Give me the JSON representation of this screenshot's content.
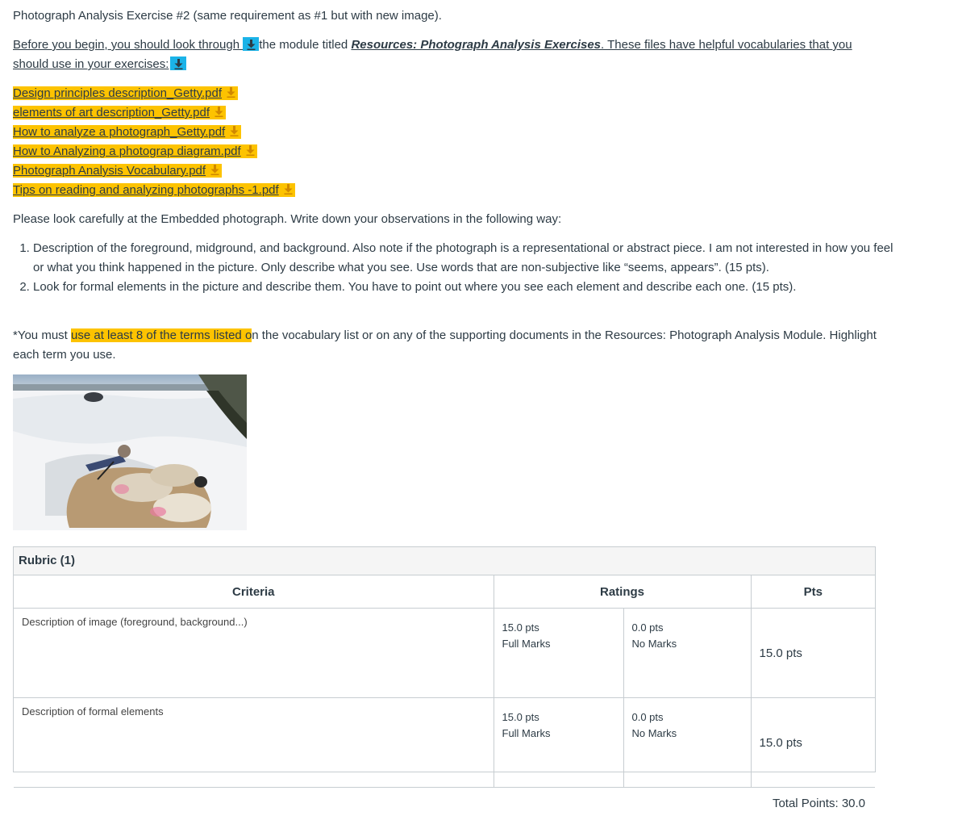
{
  "intro": "Photograph Analysis Exercise #2 (same requirement as #1 but with new image).",
  "before": {
    "part1": "Before you begin, you should look through ",
    "part2": "the module titled ",
    "module_link": "Resources: Photograph Analysis Exercises",
    "part3": ". These files have helpful vocabularies that you should use in your exercises:"
  },
  "files": [
    {
      "name": "Design principles description_Getty.pdf"
    },
    {
      "name": "elements of art description_Getty.pdf"
    },
    {
      "name": "How to analyze a photograph_Getty.pdf"
    },
    {
      "name": "How to Analyzing a photograp diagram.pdf"
    },
    {
      "name": "Photograph Analysis Vocabulary.pdf"
    },
    {
      "name": "Tips on reading and analyzing photographs -1.pdf"
    }
  ],
  "instruction": "Please look carefully at the Embedded photograph. Write down your observations in the following way:",
  "steps": [
    "Description of the foreground, midground, and background. Also note if the photograph is a representational or abstract piece. I am not interested in how you feel or what you think happened in the picture. Only describe what you see. Use words that are non-subjective like “seems, appears”. (15 pts).",
    "Look for formal elements in the picture and describe them. You have to point out where you see each element and describe each one. (15 pts)."
  ],
  "note": {
    "before": "*You must ",
    "highlight": "use at least 8 of the terms listed o",
    "after": "n the vocabulary list or on any of the supporting documents in the Resources: Photograph Analysis Module. Highlight each term you use."
  },
  "rubric": {
    "title": "Rubric (1)",
    "headers": {
      "criteria": "Criteria",
      "ratings": "Ratings",
      "pts": "Pts"
    },
    "rows": [
      {
        "criteria": "Description of image (foreground, background...)",
        "r1_pts": "15.0 pts",
        "r1_label": "Full Marks",
        "r2_pts": "0.0 pts",
        "r2_label": "No Marks",
        "pts": "15.0 pts"
      },
      {
        "criteria": "Description of formal elements",
        "r1_pts": "15.0 pts",
        "r1_label": "Full Marks",
        "r2_pts": "0.0 pts",
        "r2_label": "No Marks",
        "pts": "15.0 pts"
      }
    ],
    "total": "Total Points: 30.0"
  },
  "colors": {
    "highlight": "#fdc300",
    "download_accent": "#1bb3e8",
    "text": "#2d3b45"
  },
  "icons": {
    "download": "download-arrow-icon"
  }
}
